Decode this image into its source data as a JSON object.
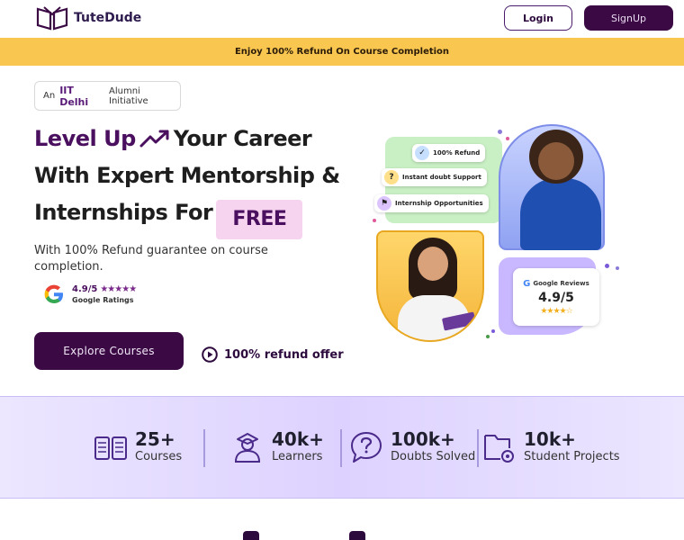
{
  "nav": {
    "brand": "TuteDude",
    "login_label": "Login",
    "signup_label": "SignUp"
  },
  "banner": {
    "text": "Enjoy 100% Refund On Course Completion"
  },
  "hero": {
    "pill_prefix": "An",
    "pill_institute": "IIT Delhi",
    "pill_suffix": "Alumni Initiative",
    "headline_accent": "Level Up",
    "headline_line1_rest": "Your Career",
    "headline_line2": "With Expert Mentorship &",
    "headline_line3": "Internships For",
    "headline_free": "FREE",
    "subtext": "With 100% Refund guarantee on course completion.",
    "rating_value": "4.9/5",
    "rating_stars": "★★★★★",
    "rating_label": "Google Ratings",
    "explore_label": "Explore Courses",
    "refund_label": "100% refund offer"
  },
  "illustration": {
    "feature_1": "100% Refund",
    "feature_2": "Instant doubt Support",
    "feature_3": "Internship Opportunities",
    "review_title": "Google Reviews",
    "review_score": "4.9/5",
    "review_stars": "★★★★☆"
  },
  "stats": [
    {
      "value": "25+",
      "label": "Courses",
      "icon": "courses-icon"
    },
    {
      "value": "40k+",
      "label": "Learners",
      "icon": "learners-icon"
    },
    {
      "value": "100k+",
      "label": "Doubts Solved",
      "icon": "doubts-icon"
    },
    {
      "value": "10k+",
      "label": "Student Projects",
      "icon": "projects-icon"
    }
  ],
  "colors": {
    "brand_purple": "#3b0a45",
    "banner_yellow": "#f9c74f",
    "accent_pink": "#f6d3ee",
    "stats_bg": "#ddd2ff"
  }
}
